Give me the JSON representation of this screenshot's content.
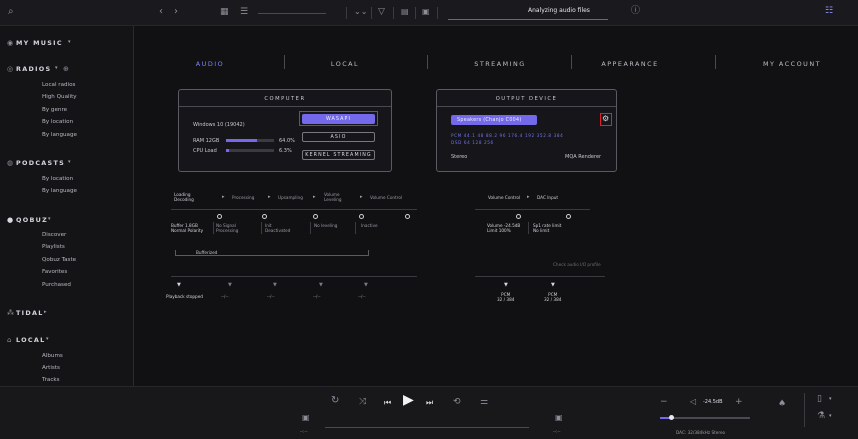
{
  "topbar": {
    "status": "Analyzing audio files"
  },
  "sidebar": {
    "my_music": "MY MUSIC",
    "radios": "RADIOS",
    "radios_items": [
      "Local radios",
      "High Quality",
      "By genre",
      "By location",
      "By language"
    ],
    "podcasts": "PODCASTS",
    "podcasts_items": [
      "By location",
      "By language"
    ],
    "qobuz": "QOBUZ",
    "qobuz_items": [
      "Discover",
      "Playlists",
      "Qobuz Taste",
      "Favorites",
      "Purchased"
    ],
    "tidal": "TIDAL",
    "local": "LOCAL",
    "local_items": [
      "Albums",
      "Artists",
      "Tracks"
    ]
  },
  "tabs": [
    "AUDIO",
    "LOCAL",
    "STREAMING",
    "APPEARANCE",
    "MY ACCOUNT"
  ],
  "computer": {
    "title": "COMPUTER",
    "os": "Windows 10 (19042)",
    "ram_label": "RAM 12GB",
    "ram_pct": "64.0%",
    "ram_fill": 0.64,
    "cpu_label": "CPU Load",
    "cpu_pct": "6.3%",
    "cpu_fill": 0.063,
    "buttons": [
      "WASAPI",
      "ASIO",
      "KERNEL STREAMING"
    ]
  },
  "output": {
    "title": "OUTPUT DEVICE",
    "device": "Speakers (Chanjo C004)",
    "pcm": "PCM  44.1  48  88.2  96  176.4  192  352.8  384",
    "dsd": "DSD  64  128  256",
    "stereo": "Stereo",
    "renderer": "MQA Renderer"
  },
  "pipeline": {
    "steps": [
      "Loading\nDecoding",
      "Processing",
      "Upsampling",
      "Volume\nLeveling",
      "Volume Control"
    ],
    "right_steps": [
      "Volume Control",
      "DAC Input"
    ],
    "values": [
      "Buffer 1.8GB\nNormal Polarity",
      "No Signal\nProcessing",
      "Init\nDeactivated",
      "No leveling",
      "Inactive"
    ],
    "right_values": [
      "Volume -24.5dB\nLimit 100%",
      "Sp1 rate limit\nNo limit"
    ],
    "buffer_label": "Bufferized",
    "check_label": "Check audio I/O profile",
    "status": "Playback stopped",
    "dashes": "--/--",
    "pcm_left": "PCM\n32 / 384",
    "pcm_right": "PCM\n32 / 384"
  },
  "player": {
    "volume": "-24.5dB",
    "volume_fill": 0.12,
    "device_info": "DAC: 32/384kHz Stereo",
    "time_left": "--:--",
    "time_right": "--:--"
  },
  "colors": {
    "accent": "#7369ea",
    "highlight": "#e0202a",
    "background": "#111113"
  }
}
